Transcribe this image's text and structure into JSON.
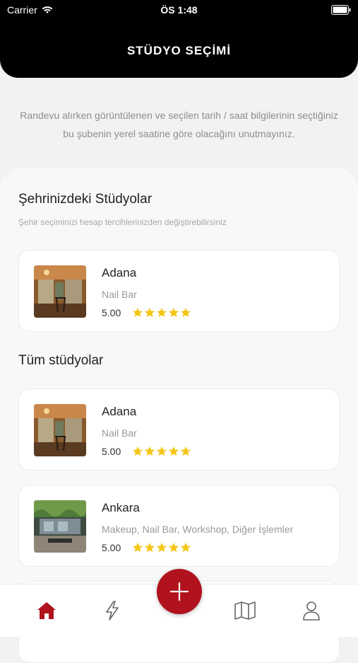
{
  "status_bar": {
    "carrier": "Carrier",
    "time": "ÖS 1:48"
  },
  "header": {
    "title": "STÜDYO SEÇİMİ"
  },
  "notice": "Randevu alırken görüntülenen ve seçilen tarih / saat bilgilerinin seçtiğiniz bu şubenin yerel saatine göre olacağını unutmayınız.",
  "city_section": {
    "title": "Şehrinizdeki Stüdyolar",
    "subtitle": "Şehir seçiminizi hesap tercihlerinizden değiştirebilirsiniz",
    "studios": [
      {
        "name": "Adana",
        "services": "Nail Bar",
        "rating": "5.00",
        "stars": 5
      }
    ]
  },
  "all_section": {
    "title": "Tüm stüdyolar",
    "studios": [
      {
        "name": "Adana",
        "services": "Nail Bar",
        "rating": "5.00",
        "stars": 5
      },
      {
        "name": "Ankara",
        "services": "Makeup, Nail Bar, Workshop, Diğer İşlemler",
        "rating": "5.00",
        "stars": 5
      }
    ]
  },
  "tabbar": {
    "items": [
      "home-icon",
      "lightning-icon",
      "map-icon",
      "user-icon"
    ],
    "fab": "plus-icon"
  },
  "colors": {
    "accent": "#b0121e",
    "star": "#f5c518",
    "header_bg": "#000000"
  }
}
